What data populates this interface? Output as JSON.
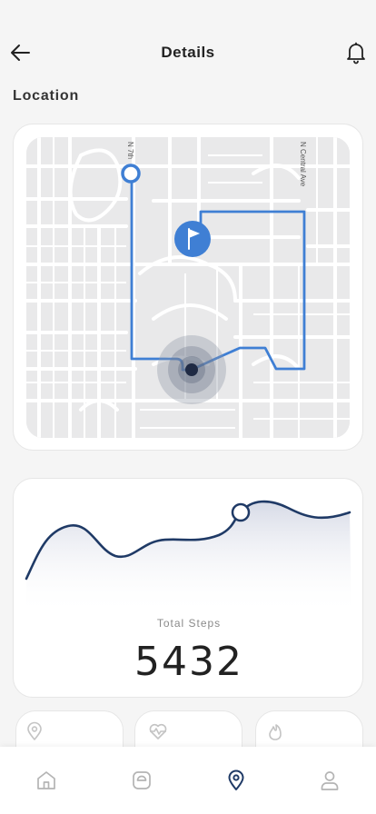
{
  "header": {
    "title": "Details",
    "back_icon": "arrow-left-icon",
    "notification_icon": "bell-icon"
  },
  "location": {
    "label": "Location",
    "map": {
      "street_labels": [
        "N 7th",
        "N Central Ave"
      ],
      "route_color": "#3f7fd4",
      "start_marker_icon": "circle-marker-icon",
      "destination_icon": "flag-icon",
      "current_position_icon": "location-dot-icon"
    }
  },
  "steps": {
    "label": "Total Steps",
    "value": "5432",
    "line_color": "#1f3a66"
  },
  "quick_cards": [
    {
      "icon": "map-pin-icon"
    },
    {
      "icon": "heart-rate-icon"
    },
    {
      "icon": "flame-icon"
    }
  ],
  "nav": {
    "items": [
      {
        "icon": "home-icon",
        "active": false
      },
      {
        "icon": "scale-icon",
        "active": false
      },
      {
        "icon": "location-pin-icon",
        "active": true
      },
      {
        "icon": "profile-icon",
        "active": false
      }
    ],
    "active_color": "#1f3a66",
    "inactive_color": "#b4b4b4"
  }
}
